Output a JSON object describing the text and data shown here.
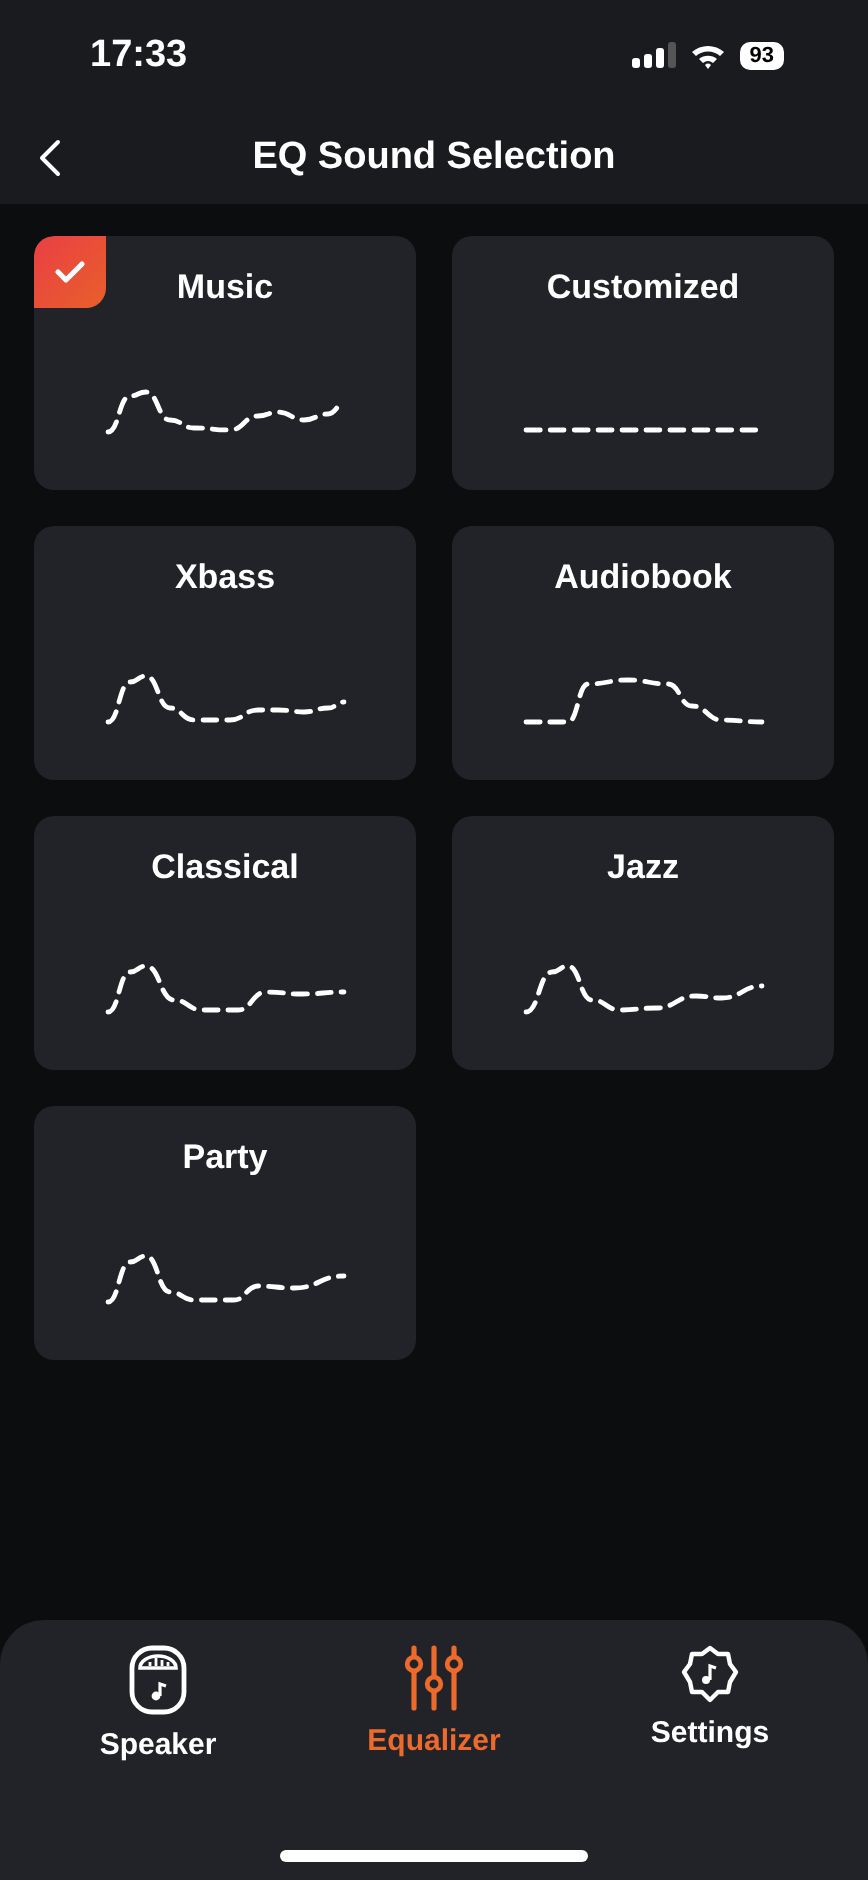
{
  "status_bar": {
    "time": "17:33",
    "battery": "93"
  },
  "header": {
    "title": "EQ Sound Selection"
  },
  "presets": [
    {
      "name": "Music",
      "selected": true
    },
    {
      "name": "Customized",
      "selected": false
    },
    {
      "name": "Xbass",
      "selected": false
    },
    {
      "name": "Audiobook",
      "selected": false
    },
    {
      "name": "Classical",
      "selected": false
    },
    {
      "name": "Jazz",
      "selected": false
    },
    {
      "name": "Party",
      "selected": false
    }
  ],
  "tabs": [
    {
      "label": "Speaker",
      "kind": "speaker",
      "selected": false
    },
    {
      "label": "Equalizer",
      "kind": "equalizer",
      "selected": true
    },
    {
      "label": "Settings",
      "kind": "settings",
      "selected": false
    }
  ]
}
